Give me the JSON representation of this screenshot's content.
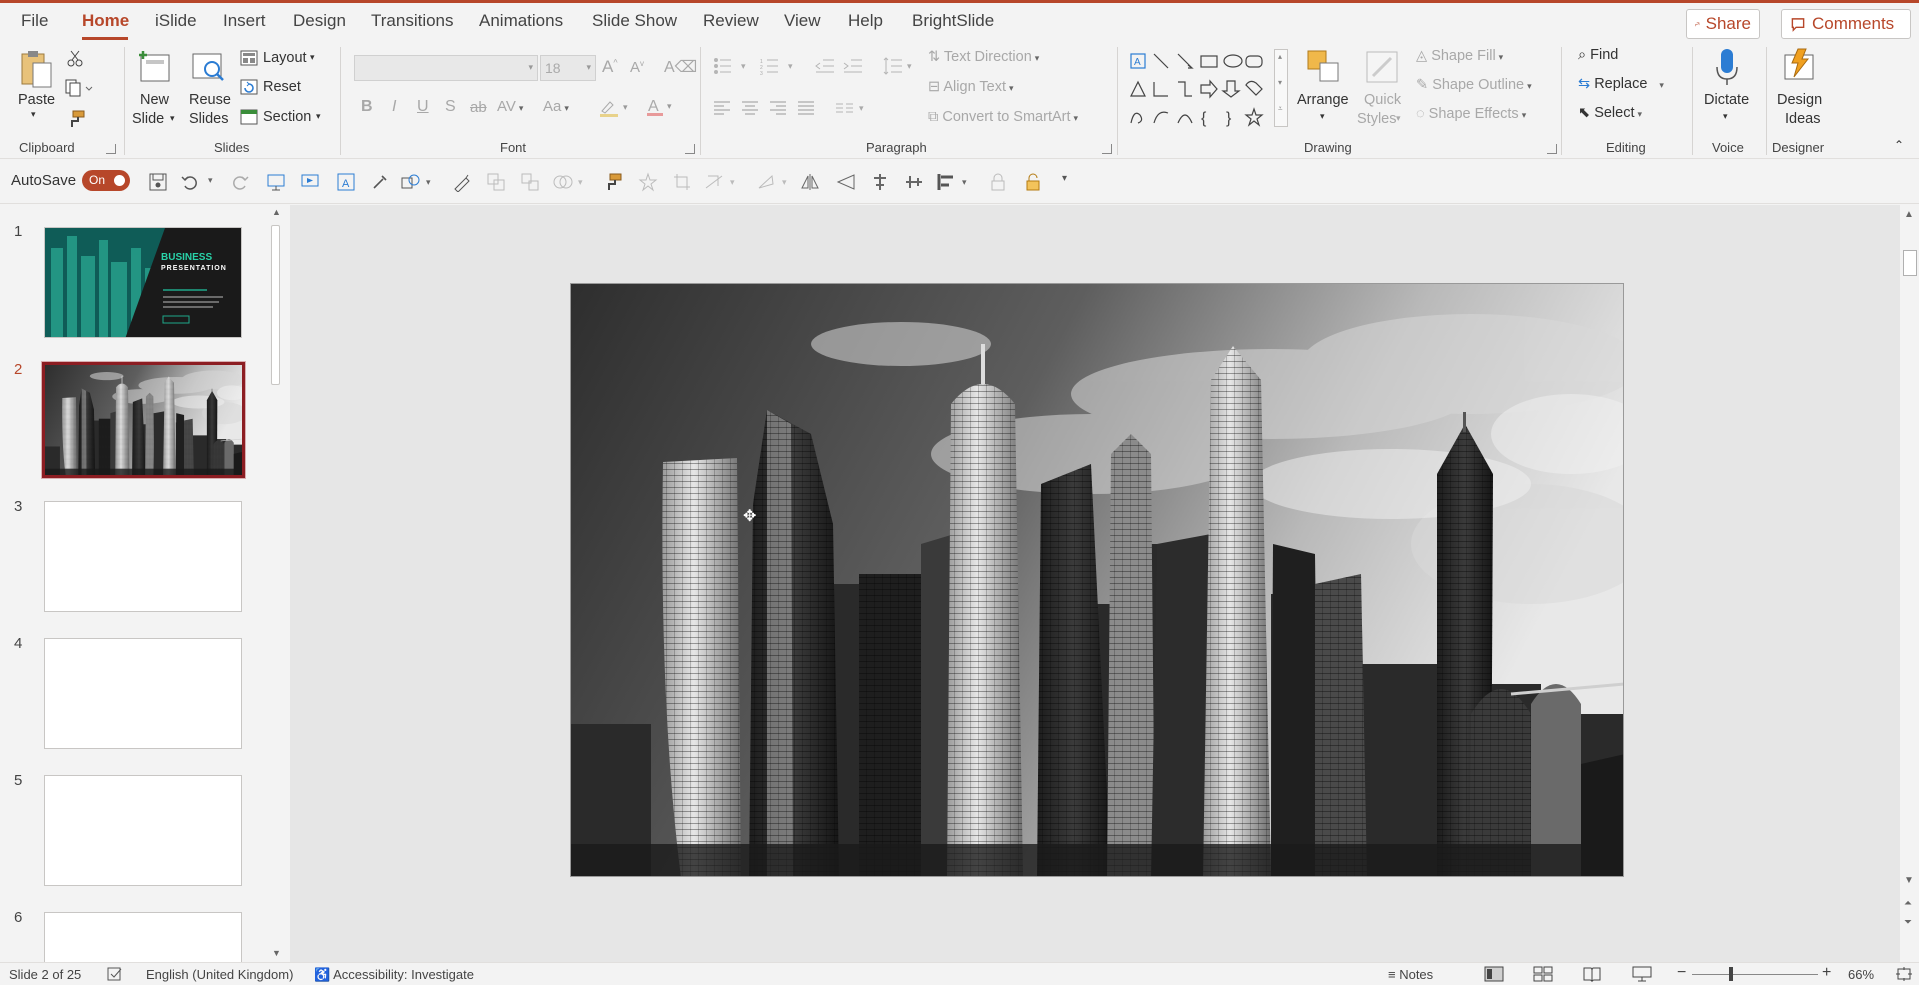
{
  "ribbon_tabs": [
    "File",
    "Home",
    "iSlide",
    "Insert",
    "Design",
    "Transitions",
    "Animations",
    "Slide Show",
    "Review",
    "View",
    "Help",
    "BrightSlide"
  ],
  "share_label": "Share",
  "comments_label": "Comments",
  "clipboard": {
    "paste": "Paste",
    "group": "Clipboard"
  },
  "slides": {
    "new_slide_1": "New",
    "new_slide_2": "Slide",
    "reuse_1": "Reuse",
    "reuse_2": "Slides",
    "layout": "Layout",
    "reset": "Reset",
    "section": "Section",
    "group": "Slides"
  },
  "font": {
    "size": "18",
    "group": "Font"
  },
  "paragraph": {
    "text_direction": "Text Direction",
    "align_text": "Align Text",
    "convert_smartart": "Convert to SmartArt",
    "group": "Paragraph"
  },
  "drawing": {
    "arrange": "Arrange",
    "quick_styles_1": "Quick",
    "quick_styles_2": "Styles",
    "shape_fill": "Shape Fill",
    "shape_outline": "Shape Outline",
    "shape_effects": "Shape Effects",
    "group": "Drawing"
  },
  "editing": {
    "find": "Find",
    "replace": "Replace",
    "select": "Select",
    "group": "Editing"
  },
  "voice": {
    "dictate": "Dictate",
    "group": "Voice"
  },
  "designer": {
    "design_1": "Design",
    "design_2": "Ideas",
    "group": "Designer"
  },
  "qat": {
    "autosave": "AutoSave",
    "toggle": "On"
  },
  "thumbnails": [
    {
      "num": "1",
      "title_1": "BUSINESS",
      "title_2": "PRESENTATION"
    },
    {
      "num": "2"
    },
    {
      "num": "3"
    },
    {
      "num": "4"
    },
    {
      "num": "5"
    },
    {
      "num": "6"
    }
  ],
  "status": {
    "slide_counter": "Slide 2 of 25",
    "language": "English (United Kingdom)",
    "accessibility": "Accessibility: Investigate",
    "notes": "Notes",
    "zoom": "66%"
  },
  "colors": {
    "accent": "#b7472a",
    "selected_thumb_border": "#8c1d22",
    "teal": "#1fa88a"
  },
  "icons": [
    "cut-icon",
    "copy-icon",
    "format-painter-icon",
    "shapes-gallery-icon",
    "find-icon",
    "replace-icon",
    "select-icon",
    "microphone-icon",
    "design-ideas-icon",
    "save-icon",
    "undo-icon",
    "redo-icon"
  ]
}
